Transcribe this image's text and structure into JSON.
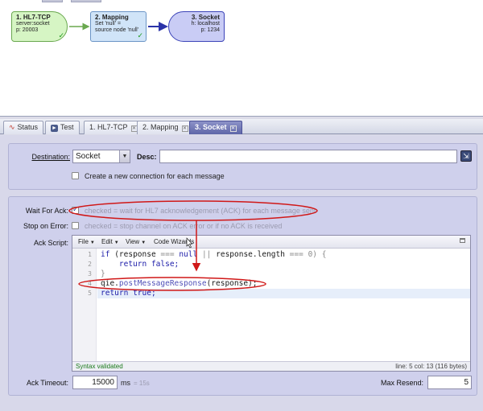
{
  "flow": {
    "nodes": [
      {
        "title": "1. HL7-TCP",
        "line1": "server:socket",
        "line2": "p: 20003"
      },
      {
        "title": "2. Mapping",
        "line1": "Set 'null' =",
        "line2": "source node 'null'"
      },
      {
        "title": "3. Socket",
        "line1": "h: localhost",
        "line2": "p: 1234"
      }
    ]
  },
  "tabs": [
    {
      "label": "Status",
      "icon": "pulse-icon"
    },
    {
      "label": "Test",
      "icon": "test-icon"
    },
    {
      "label": "1. HL7-TCP"
    },
    {
      "label": "2. Mapping"
    },
    {
      "label": "3. Socket"
    }
  ],
  "destination": {
    "label": "Destination:",
    "value": "Socket",
    "desc_label": "Desc:",
    "desc_value": "",
    "new_connection_label": "Create a new connection for each message"
  },
  "ack": {
    "wait_label": "Wait For Ack:",
    "wait_checked": true,
    "wait_text": "checked = wait for HL7 acknowledgement (ACK) for each message sent",
    "stop_label": "Stop on Error:",
    "stop_checked": false,
    "stop_text": "checked = stop channel on ACK error or if no ACK is received",
    "script_label": "Ack Script:",
    "timeout_label": "Ack Timeout:",
    "timeout_value": "15000",
    "timeout_unit": "ms",
    "timeout_hint": "= 15s",
    "max_resend_label": "Max Resend:",
    "max_resend_value": "5"
  },
  "editor": {
    "menus": [
      "File",
      "Edit",
      "View",
      "Code Wizards"
    ],
    "line_numbers": [
      "1",
      "2",
      "3",
      "4",
      "5"
    ],
    "code_line1": {
      "kw_if": "if",
      "a": "(response",
      "op1": "===",
      "null": "null",
      "or": "||",
      "b": "response.length",
      "op2": "===",
      "zero": "0)",
      "brace": "{"
    },
    "code_line2": {
      "kw": "return",
      "val": "false;"
    },
    "code_line3": "}",
    "code_line4": {
      "obj": "qie",
      "dot": ".",
      "fn": "postMessageResponse",
      "args": "(response);"
    },
    "code_line5": {
      "kw": "return",
      "val": "true;"
    },
    "status_left": "Syntax validated",
    "status_right": "line: 5  col: 13   (116 bytes)"
  },
  "colors": {
    "accent": "#5f66a8",
    "annotation": "#d01818",
    "ok": "#1a7a1a"
  }
}
